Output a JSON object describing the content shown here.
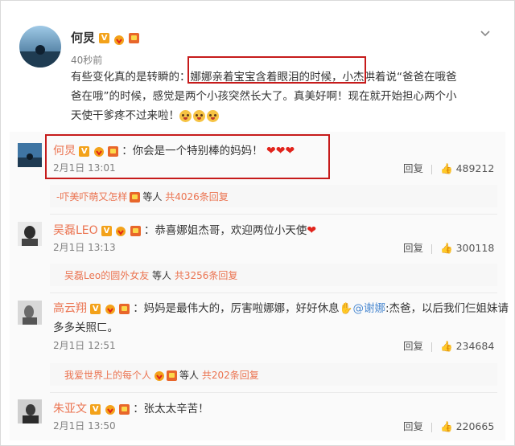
{
  "post": {
    "author": "何炅",
    "time": "40秒前",
    "text_part1": "有些变化真的是转瞬的：",
    "text_highlight": "娜娜亲着宝宝含着眼泪的时候，",
    "text_part2": "小杰哄着说“爸爸在哦爸",
    "text_line2": "爸在哦”的时候，感觉是两个小孩突然长大了。真美好啊！现在就开始担心两个小",
    "text_line3": "天使干爹疼不过来啦！",
    "menu_icon": "chevron-down-icon"
  },
  "comments": [
    {
      "author": "何炅",
      "text": "：你会是一个特别棒的妈妈！",
      "hearts": "❤❤❤",
      "date": "2月1日 13:01",
      "reply_label": "回复",
      "likes": "489212",
      "replies_user": "-吓美吓萌又怎样",
      "replies_mid": "等人",
      "replies_count": "共4026条回复"
    },
    {
      "author": "吴磊LEO",
      "text": "：恭喜娜姐杰哥，欢迎两位小天使",
      "hearts": "❤",
      "date": "2月1日 13:13",
      "reply_label": "回复",
      "likes": "300118",
      "replies_user": "吴磊Leo的圆外女友",
      "replies_mid": "等人",
      "replies_count": "共3256条回复"
    },
    {
      "author": "高云翔",
      "text1": "：妈妈是最伟大的，厉害啦娜娜，好好休息",
      "mention": "@谢娜",
      "text2": ":杰爸，以后我们仨姐妹请",
      "text_line2": "多多关照ㄈ。",
      "date": "2月1日 12:51",
      "reply_label": "回复",
      "likes": "234684",
      "replies_user": "我爱世界上的每个人",
      "replies_mid": "等人",
      "replies_count": "共202条回复"
    },
    {
      "author": "朱亚文",
      "text": "：张太太辛苦！",
      "date": "2月1日 13:50",
      "reply_label": "回复",
      "likes": "220665"
    }
  ],
  "colors": {
    "name": "#eb7350",
    "highlight_box": "#c61b1b",
    "link": "#4c8ad1"
  }
}
